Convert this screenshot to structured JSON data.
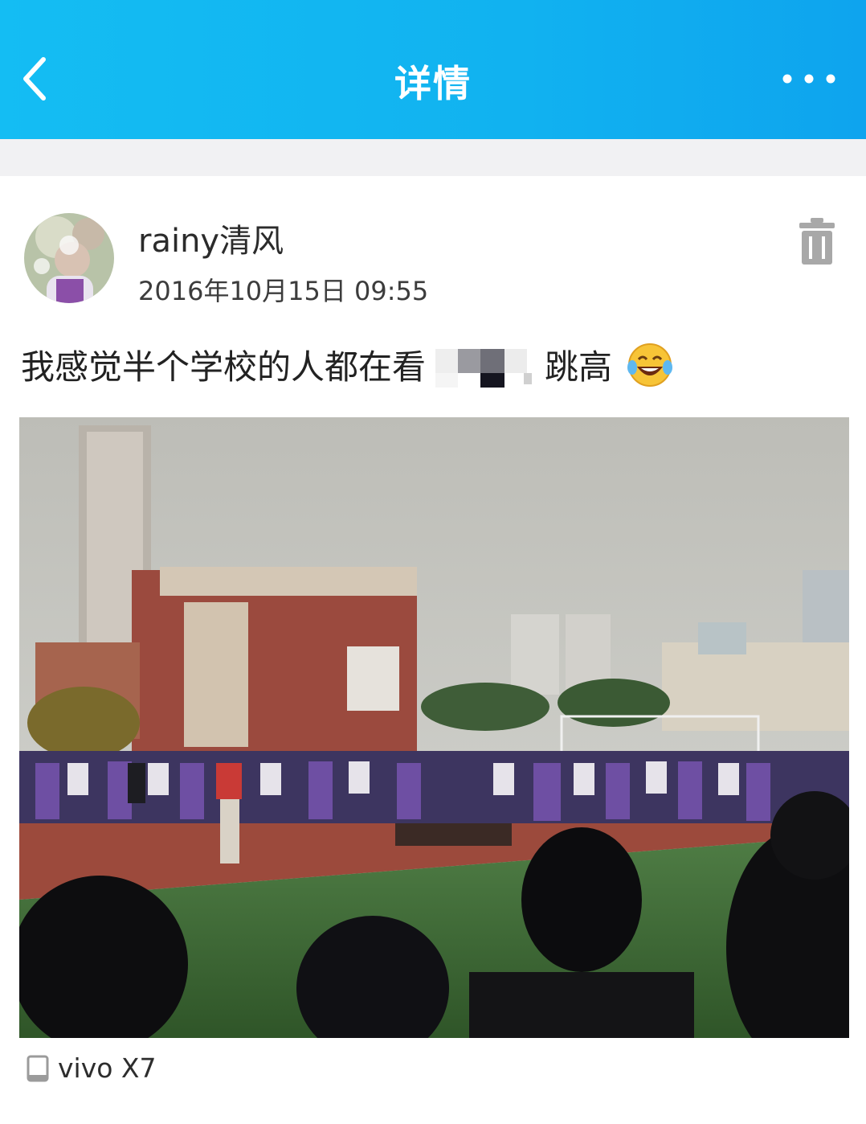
{
  "header": {
    "title": "详情"
  },
  "post": {
    "username": "rainy清风",
    "timestamp": "2016年10月15日 09:55",
    "text_before": "我感觉半个学校的人都在看",
    "text_after": "跳高",
    "device": "vivo X7"
  },
  "icons": {
    "back": "chevron-left-icon",
    "more": "more-dots-icon",
    "delete": "trash-icon",
    "emoji": "laughing-tears-emoji",
    "device": "phone-icon"
  },
  "colors": {
    "header": "#11b2f0",
    "divider": "#f1f1f3",
    "icon_gray": "#a8a8a8"
  }
}
